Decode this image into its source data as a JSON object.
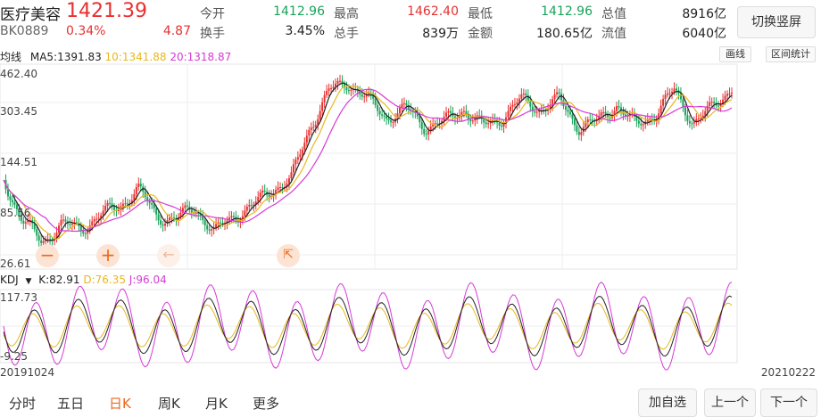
{
  "stock": {
    "name": "医疗美容",
    "price": "1421.39",
    "code": "BK0889",
    "change_pct": "0.34%",
    "change": "4.87"
  },
  "stats": [
    {
      "label": "今开",
      "value": "1412.96",
      "color": "green"
    },
    {
      "label": "最高",
      "value": "1462.40",
      "color": "red"
    },
    {
      "label": "最低",
      "value": "1412.96",
      "color": "green"
    },
    {
      "label": "总值",
      "value": "8916亿",
      "color": "dark"
    },
    {
      "label": "换手",
      "value": "3.45%",
      "color": "dark"
    },
    {
      "label": "总手",
      "value": "839万",
      "color": "dark"
    },
    {
      "label": "金额",
      "value": "180.65亿",
      "color": "dark"
    },
    {
      "label": "流值",
      "value": "6040亿",
      "color": "dark"
    }
  ],
  "buttons": {
    "switch": "切换竖屏",
    "draw": "画线",
    "interval": "区间统计",
    "add": "加自选",
    "prev": "上一个",
    "next": "下一个"
  },
  "ma": {
    "label": "均线",
    "ma5": "MA5:1391.83",
    "ma10": "10:1341.88",
    "ma20": "20:1318.87"
  },
  "kdj": {
    "label": "KDJ",
    "k": "K:82.91",
    "d": "D:76.35",
    "j": "J:96.04"
  },
  "colors": {
    "up": "#e93030",
    "down": "#18a35a",
    "ma5": "#222222",
    "ma10": "#e8b820",
    "ma20": "#d63bd6",
    "accent": "#e96a1c"
  },
  "icons": {
    "zoom_out": "minus-icon",
    "zoom_in": "plus-icon",
    "left": "arrow-left-icon",
    "shrink": "arrow-shrink-icon"
  },
  "dates": {
    "start": "20191024",
    "end": "20210222"
  },
  "tabs": [
    "分时",
    "五日",
    "日K",
    "周K",
    "月K",
    "更多"
  ],
  "active_tab": "日K",
  "chart_data": [
    {
      "type": "candlestick",
      "y_ticks": [
        "462.40",
        "303.45",
        "144.51",
        "85.56",
        "26.61"
      ],
      "ylim": [
        26.61,
        462.4
      ],
      "x_range": [
        "20191024",
        "20210222"
      ],
      "series": [
        {
          "name": "MA5",
          "last": "1391.83"
        },
        {
          "name": "MA10",
          "last": "1341.88"
        },
        {
          "name": "MA20",
          "last": "1318.87"
        }
      ],
      "close_path": [
        120,
        165,
        190,
        170,
        175,
        160,
        150,
        130,
        160,
        165,
        150,
        180,
        160,
        150,
        130,
        120,
        60,
        20,
        10,
        30,
        50,
        40,
        60,
        55,
        40,
        60,
        50,
        30,
        40,
        30,
        60,
        55,
        35,
        60,
        45,
        20,
        55,
        40,
        15
      ],
      "grid": true
    },
    {
      "type": "line",
      "name": "KDJ",
      "y_ticks": [
        "117.73",
        "-9.25"
      ],
      "ylim": [
        -9.25,
        117.73
      ],
      "series": [
        {
          "name": "K",
          "last": "82.91"
        },
        {
          "name": "D",
          "last": "76.35"
        },
        {
          "name": "J",
          "last": "96.04"
        }
      ]
    }
  ]
}
